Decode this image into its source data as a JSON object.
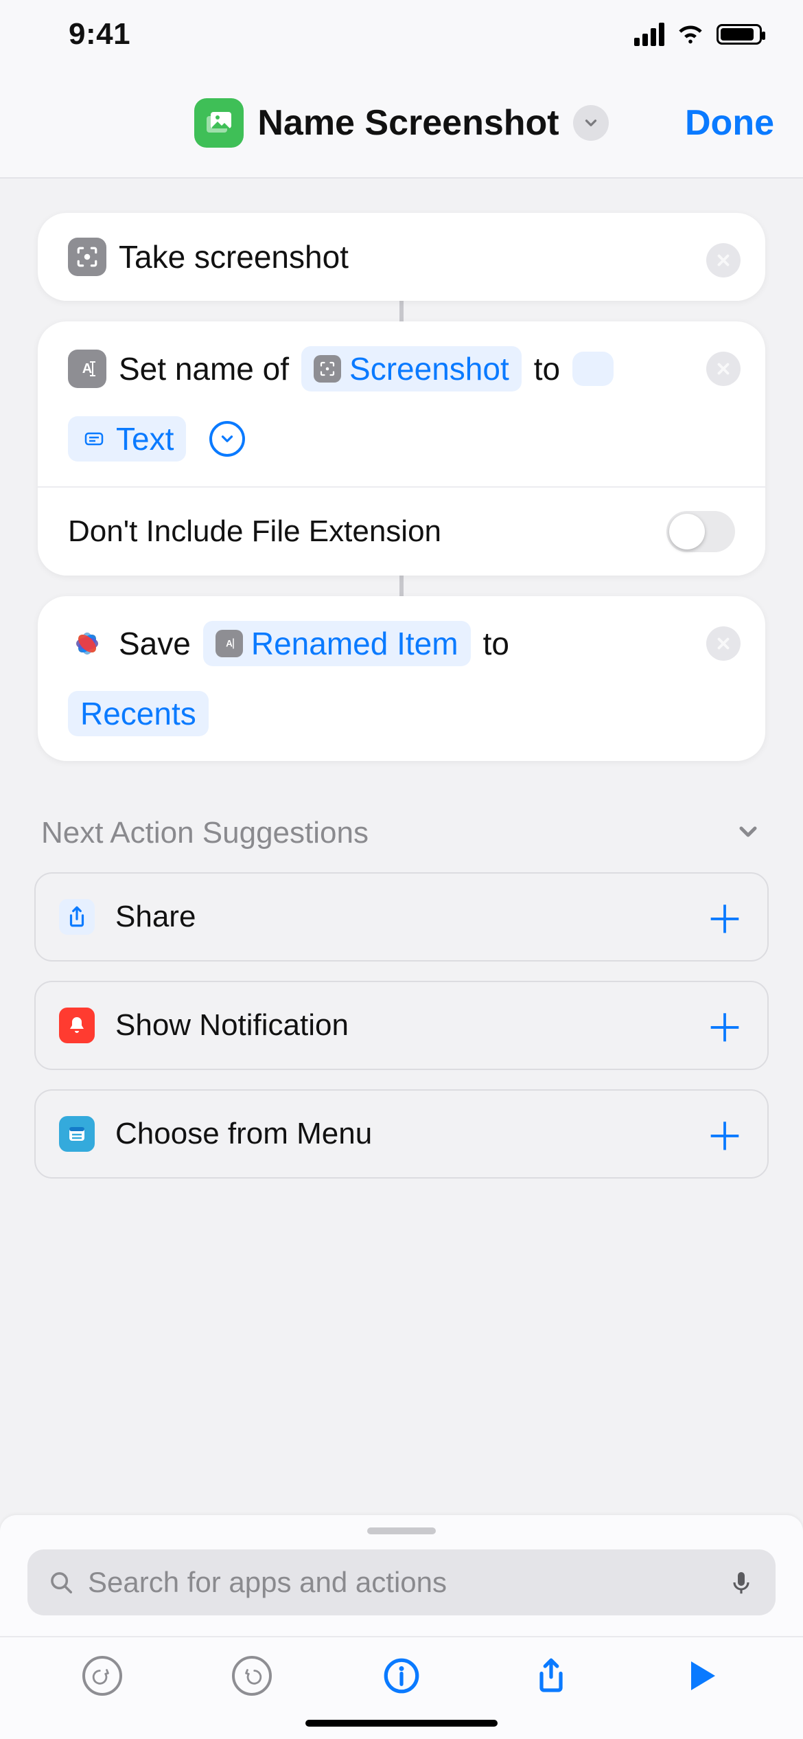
{
  "status": {
    "time": "9:41"
  },
  "header": {
    "title": "Name Screenshot",
    "done": "Done"
  },
  "actions": {
    "take_screenshot": {
      "label": "Take screenshot"
    },
    "set_name": {
      "prefix": "Set name of",
      "var1": "Screenshot",
      "mid": "to",
      "var2": "Text",
      "option_label": "Don't Include File Extension"
    },
    "save": {
      "prefix": "Save",
      "var1": "Renamed Item",
      "mid": "to",
      "var2": "Recents"
    }
  },
  "suggestions": {
    "title": "Next Action Suggestions",
    "items": [
      {
        "label": "Share"
      },
      {
        "label": "Show Notification"
      },
      {
        "label": "Choose from Menu"
      }
    ]
  },
  "search": {
    "placeholder": "Search for apps and actions"
  }
}
